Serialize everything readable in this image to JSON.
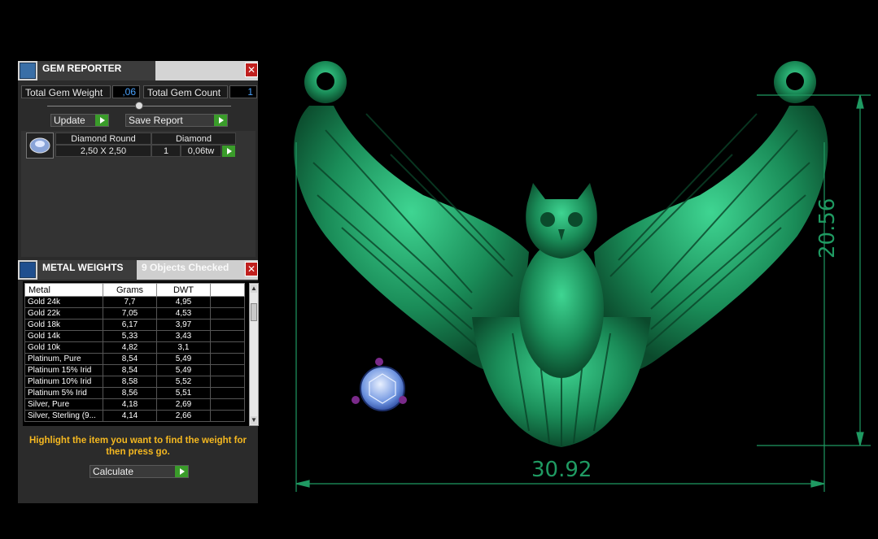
{
  "gem_reporter": {
    "title": "GEM REPORTER",
    "total_gem_weight_label": "Total Gem Weight",
    "total_gem_weight_value": ",06",
    "total_gem_count_label": "Total Gem Count",
    "total_gem_count_value": "1",
    "update_label": "Update",
    "save_report_label": "Save Report",
    "gem_row": {
      "shape": "Diamond Round",
      "size": "2,50 X 2,50",
      "material": "Diamond",
      "count": "1",
      "weight": "0,06tw"
    }
  },
  "metal_weights": {
    "title": "METAL WEIGHTS",
    "objects_checked": "9 Objects Checked",
    "headers": [
      "Metal",
      "Grams",
      "DWT"
    ],
    "rows": [
      [
        "Gold 24k",
        "7,7",
        "4,95"
      ],
      [
        "Gold 22k",
        "7,05",
        "4,53"
      ],
      [
        "Gold 18k",
        "6,17",
        "3,97"
      ],
      [
        "Gold 14k",
        "5,33",
        "3,43"
      ],
      [
        "Gold 10k",
        "4,82",
        "3,1"
      ],
      [
        "Platinum, Pure",
        "8,54",
        "5,49"
      ],
      [
        "Platinum 15% Irid",
        "8,54",
        "5,49"
      ],
      [
        "Platinum 10% Irid",
        "8,58",
        "5,52"
      ],
      [
        "Platinum 5% Irid",
        "8,56",
        "5,51"
      ],
      [
        "Silver, Pure",
        "4,18",
        "2,69"
      ],
      [
        "Silver, Sterling (9...",
        "4,14",
        "2,66"
      ]
    ],
    "hint": "Highlight the item you want to find the weight for then press go.",
    "calculate_label": "Calculate"
  },
  "viewport": {
    "width_dimension": "30.92",
    "height_dimension": "20.56",
    "model_color": "#1f9a62"
  }
}
